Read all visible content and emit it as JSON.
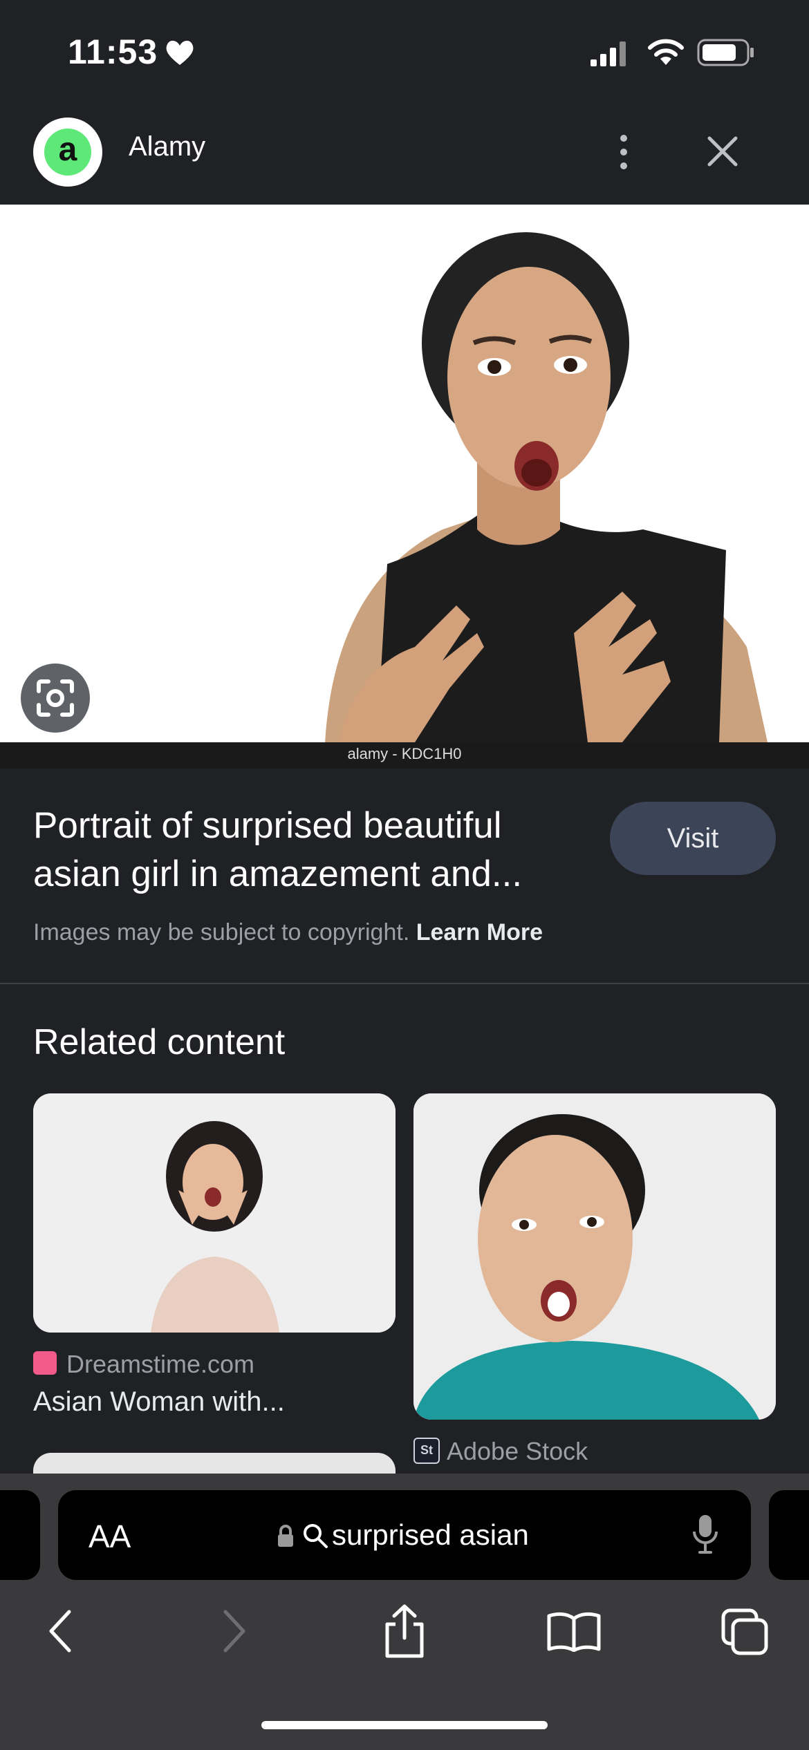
{
  "status_bar": {
    "time": "11:53"
  },
  "header": {
    "site_logo_letter": "a",
    "site_name": "Alamy"
  },
  "image": {
    "caption": "alamy - KDC1H0"
  },
  "result": {
    "title": "Portrait of surprised beautiful asian girl in amazement and...",
    "visit_label": "Visit",
    "copyright_text": "Images may be subject to copyright.",
    "learn_more_label": "Learn More"
  },
  "related": {
    "heading": "Related content",
    "items": [
      {
        "source": "Dreamstime.com",
        "title": "Asian Woman with..."
      },
      {
        "source": "Adobe Stock",
        "badge": "St"
      }
    ]
  },
  "browser": {
    "text_size_label": "AA",
    "address": "surprised asian"
  },
  "colors": {
    "background": "#202124",
    "visit_button": "#3c4457",
    "toolbar": "#3a3a3c"
  }
}
